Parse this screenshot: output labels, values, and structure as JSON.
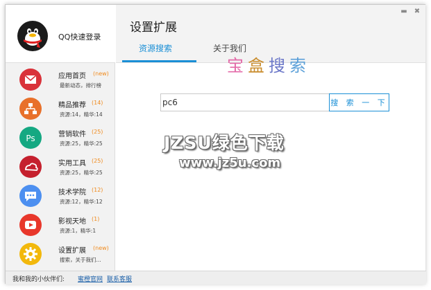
{
  "window": {
    "minimize_symbol": "▬",
    "close_symbol": "✖"
  },
  "sidebar": {
    "login_label": "QQ快速登录",
    "items": [
      {
        "icon": "mail-icon",
        "color": "#d9323a",
        "title": "应用首页",
        "badge": "(new)",
        "sub": "最新动态，排行榜"
      },
      {
        "icon": "sitemap-icon",
        "color": "#e8702a",
        "title": "精品推荐",
        "badge": "(14)",
        "sub": "资源:14，精华:14"
      },
      {
        "icon": "photoshop-icon",
        "color": "#15a882",
        "title": "营销软件",
        "badge": "(25)",
        "sub": "资源:25，精华:25"
      },
      {
        "icon": "creative-cloud-icon",
        "color": "#c5202e",
        "title": "实用工具",
        "badge": "(25)",
        "sub": "资源:25，精华:25"
      },
      {
        "icon": "chat-icon",
        "color": "#4c8ff0",
        "title": "技术学院",
        "badge": "(12)",
        "sub": "资源:12，精华:12"
      },
      {
        "icon": "play-icon",
        "color": "#e8372b",
        "title": "影视天地",
        "badge": "(1)",
        "sub": "资源:1，精华:1"
      },
      {
        "icon": "gear-icon",
        "color": "#f2b80c",
        "title": "设置扩展",
        "badge": "(new)",
        "sub": "搜索，关于我们..."
      }
    ]
  },
  "main": {
    "title": "设置扩展",
    "tabs": [
      {
        "label": "资源搜索",
        "active": true
      },
      {
        "label": "关于我们",
        "active": false
      }
    ],
    "brand_chars": [
      "宝",
      "盒",
      "搜",
      "索"
    ],
    "search_value": "pc6",
    "search_button": "搜 索 一 下",
    "accent_color": "#1a8fd6"
  },
  "watermark": {
    "big": "JZSU绿色下载",
    "small": "www.jz5u.com"
  },
  "footer": {
    "label": "我和我的小伙伴们:",
    "links": [
      "蜜橙官网",
      "联系客服"
    ]
  }
}
